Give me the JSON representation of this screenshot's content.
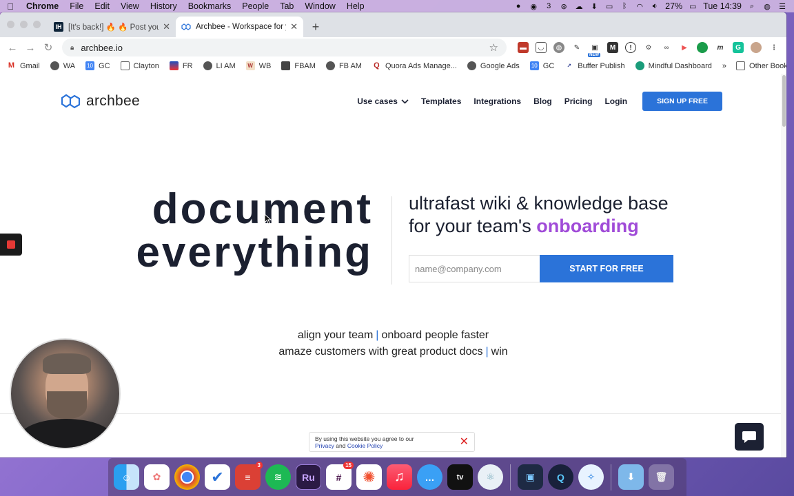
{
  "menubar": {
    "app": "Chrome",
    "items": [
      "File",
      "Edit",
      "View",
      "History",
      "Bookmarks",
      "People",
      "Tab",
      "Window",
      "Help"
    ],
    "battery": "27%",
    "clock": "Tue 14:39",
    "badge_count": "3"
  },
  "tabs": [
    {
      "favicon": "IH",
      "title": "[It's back!] 🔥 🔥 Post your SAAS"
    },
    {
      "favicon": "archbee-logo",
      "title": "Archbee - Workspace for your team"
    }
  ],
  "toolbar": {
    "url": "archbee.io",
    "ext_badge": "NEW"
  },
  "bookmarks": {
    "items": [
      "Gmail",
      "WA",
      "GC",
      "Clayton",
      "FR",
      "LI AM",
      "WB",
      "FBAM",
      "FB AM",
      "Quora Ads Manage...",
      "Google Ads",
      "GC",
      "Buffer Publish",
      "Mindful Dashboard"
    ],
    "overflow": "»",
    "other": "Other Bookmarks"
  },
  "site": {
    "logo": "archbee",
    "nav": [
      "Use cases",
      "Templates",
      "Integrations",
      "Blog",
      "Pricing",
      "Login"
    ],
    "signup": "SIGN UP FREE",
    "hero_line1": "document",
    "hero_line2": "everything",
    "sub_line1": "ultrafast wiki & knowledge base",
    "sub_line2_prefix": "for your team's ",
    "sub_line2_accent": "onboarding",
    "email_placeholder": "name@company.com",
    "cta": "START FOR FREE",
    "tag1a": "align your team",
    "tag1b": "onboard people faster",
    "tag2a": "amaze customers with great product docs",
    "tag2b": "win",
    "sep": "|",
    "cookie_line1": "By using this website you agree to our",
    "cookie_privacy": "Privacy",
    "cookie_and": "and",
    "cookie_policy": "Cookie Policy"
  },
  "dock": {
    "slack_badge": "15",
    "todoist_badge": "3",
    "ru_label": "Ru"
  },
  "colors": {
    "accent": "#2b73d9",
    "onboarding": "#a04bd8",
    "dark": "#1b2030"
  }
}
